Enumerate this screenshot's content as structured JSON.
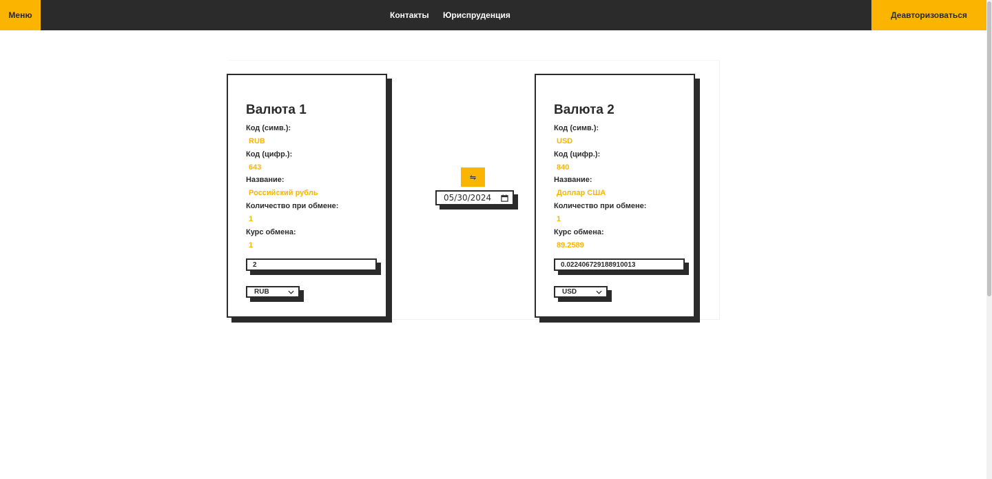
{
  "topbar": {
    "menu_label": "Меню",
    "nav": [
      "Контакты",
      "Юриспруденция"
    ],
    "logout_label": "Деавторизоваться"
  },
  "colors": {
    "accent": "#fbb400",
    "dark": "#2b2b2b",
    "background": "#ffffff"
  },
  "converter": {
    "swap_icon": "⇋",
    "date": "05/30/2024",
    "currency1": {
      "title": "Валюта 1",
      "char_code_label": "Код (симв.):",
      "char_code": "RUB",
      "num_code_label": "Код (цифр.):",
      "num_code": "643",
      "name_label": "Название:",
      "name": "Российский рубль",
      "nominal_label": "Количество при обмене:",
      "nominal": "1",
      "rate_label": "Курс обмена:",
      "rate": "1",
      "amount": "2",
      "selected": "RUB"
    },
    "currency2": {
      "title": "Валюта 2",
      "char_code_label": "Код (симв.):",
      "char_code": "USD",
      "num_code_label": "Код (цифр.):",
      "num_code": "840",
      "name_label": "Название:",
      "name": "Доллар США",
      "nominal_label": "Количество при обмене:",
      "nominal": "1",
      "rate_label": "Курс обмена:",
      "rate": "89.2589",
      "amount": "0.022406729188910013",
      "selected": "USD"
    }
  }
}
